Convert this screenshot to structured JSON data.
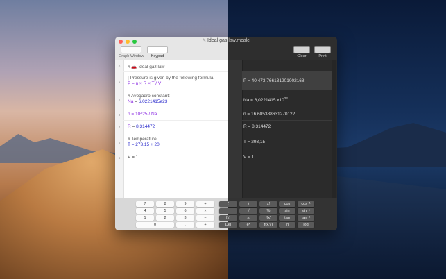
{
  "window": {
    "title_left": "Ideal gas ",
    "title_right": "law.mcalc",
    "toolbar": {
      "graph_window": "Graph Window",
      "keypad": "Keypad",
      "clear": "Clear",
      "print": "Print"
    },
    "colors": {
      "close": "#ff5f57",
      "minimize": "#febc2e",
      "zoom": "#28c840"
    }
  },
  "editor": {
    "line_numbers": [
      "0",
      "1",
      "2",
      "3",
      "4",
      "5",
      "6"
    ],
    "lines": [
      {
        "text": "# 🚗 Ideal gaz law"
      },
      {
        "comment": "Pressure is given by the following formula:",
        "code": "P = n × R × T / V"
      },
      {
        "comment": "# Avogadro constant:",
        "code_var": "Na",
        "code_eq": " = ",
        "code_num": "6.0221415e23"
      },
      {
        "code": "n = 10^25 / Na"
      },
      {
        "code_var": "R",
        "code_eq": " = ",
        "code_num": "8.314472"
      },
      {
        "comment": "# Temperature:",
        "code": "T = 273.15 + 20"
      },
      {
        "code": "V = 1"
      }
    ]
  },
  "results": {
    "P": "P = 40 473,766131201002168",
    "Na": "Na = 6,0221415 x10",
    "Na_exp": "23",
    "n": "n = 16,605388631270122",
    "R": "R = 8,314472",
    "T": "T = 293,15",
    "V": "V = 1"
  },
  "keypad": {
    "left": [
      "7",
      "8",
      "9",
      "+",
      "4",
      "5",
      "6",
      "×",
      "1",
      "2",
      "3",
      "−",
      "0",
      ".",
      "+"
    ],
    "right": [
      "(",
      ")",
      "x!",
      "cos",
      "cos⁻¹",
      "",
      "√",
      "%",
      "sin",
      "sin⁻¹",
      "[x]",
      "π",
      "f(x)",
      "tan",
      "tan⁻¹",
      "Del",
      "eˣ",
      "f(x,y)",
      "ln",
      "log"
    ]
  }
}
